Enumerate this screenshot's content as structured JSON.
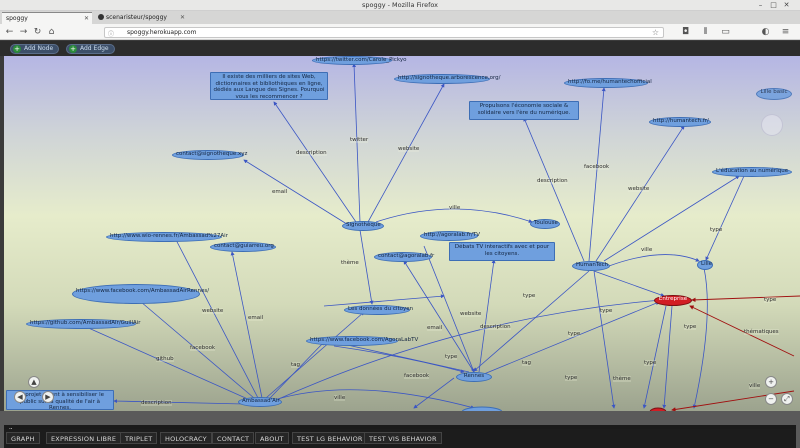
{
  "window": {
    "title": "spoggy - Mozilla Firefox",
    "tabs": [
      {
        "label": "spoggy",
        "active": true
      },
      {
        "label": "scenaristeur/spoggy",
        "active": false
      }
    ],
    "url": "spoggy.herokuapp.com"
  },
  "toolbar": {
    "add_node": "Add Node",
    "add_edge": "Add Edge"
  },
  "graph": {
    "nodes": [
      {
        "id": "n1",
        "label": "https://twitter.com/Carole_Pickyo"
      },
      {
        "id": "n2",
        "label": "Il existe des milliers de sites Web, dictionnaires et bibliothèques en ligne, dédiés aux Langue des Signes. Pourquoi vous les recommencer ?"
      },
      {
        "id": "n3",
        "label": "http://signotheque.arborescence.org/"
      },
      {
        "id": "n4",
        "label": "http://fo.me/humantechofficial"
      },
      {
        "id": "n5",
        "label": "Propulsons l'économie sociale & solidaire vers l'ère du numérique."
      },
      {
        "id": "n6",
        "label": "http://humantech.fr/"
      },
      {
        "id": "n7",
        "label": "L'éducation au numérique"
      },
      {
        "id": "n8",
        "label": "contact@signotheque.xyz"
      },
      {
        "id": "n9",
        "label": "Signothèque"
      },
      {
        "id": "n10",
        "label": "Toulouse"
      },
      {
        "id": "n11",
        "label": "http://agoralab.fr/TV"
      },
      {
        "id": "n12",
        "label": "Débats TV interactifs avec et pour les citoyens."
      },
      {
        "id": "n13",
        "label": "http://www.wio-rennes.fr/Ambassad%27Air"
      },
      {
        "id": "n14",
        "label": "contact@guiarreu.org"
      },
      {
        "id": "n15",
        "label": "contact@agoralab.fr"
      },
      {
        "id": "n16",
        "label": "HumanTech"
      },
      {
        "id": "n17",
        "label": "Lille"
      },
      {
        "id": "n18",
        "label": "https://www.facebook.com/AmbassadAirRennes/"
      },
      {
        "id": "n19",
        "label": "Entreprise"
      },
      {
        "id": "n20",
        "label": "Les données du citoyen"
      },
      {
        "id": "n21",
        "label": "https://github.com/AmbassadAir/GuillAir"
      },
      {
        "id": "n22",
        "label": "https://www.facebook.com/AgoraLabTV"
      },
      {
        "id": "n23",
        "label": "Rennes"
      },
      {
        "id": "n24",
        "label": "Ambassad'Air"
      },
      {
        "id": "n25",
        "label": "Un projet visant à sensibiliser le public sur la qualité de l'air à Rennes."
      },
      {
        "id": "n26",
        "label": "Lille basic"
      }
    ],
    "edge_labels": [
      "twitter",
      "description",
      "website",
      "email",
      "ville",
      "facebook",
      "description",
      "website",
      "type",
      "thème",
      "email",
      "website",
      "description",
      "type",
      "website",
      "email",
      "facebook",
      "github",
      "tag",
      "facebook",
      "type",
      "tag",
      "type",
      "thème",
      "type",
      "type",
      "thématiques",
      "type",
      "ville",
      "description",
      "ville",
      "ville",
      "type",
      "type"
    ]
  },
  "command_line": {
    "value": "/t"
  },
  "menu": [
    "GRAPH",
    "EXPRESSION LIBRE",
    "TRIPLET",
    "HOLOCRACY",
    "CONTACT",
    "ABOUT",
    "TEST LG BEHAVIOR",
    "TEST VIS BEHAVIOR"
  ],
  "colors": {
    "node_fill": "#6f9fde",
    "node_border": "#3d6eb5",
    "edge": "#3b56c4",
    "edge_type": "#a01010",
    "highlight_node": "#d21d24"
  }
}
